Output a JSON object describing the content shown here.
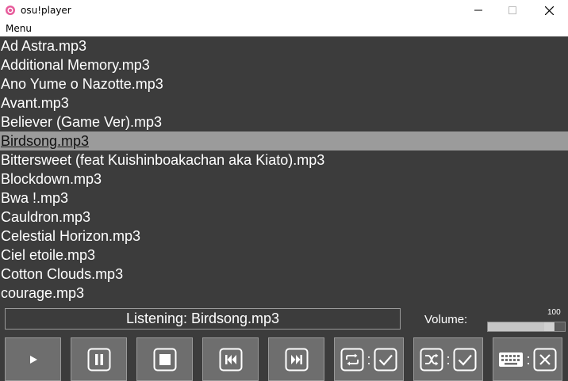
{
  "window": {
    "title": "osu!player",
    "minimize_glyph": "—",
    "maximize_glyph": "☐",
    "close_glyph": "✕"
  },
  "menu": {
    "label": "Menu"
  },
  "playlist": {
    "tracks": [
      "Ad Astra.mp3",
      "Additional Memory.mp3",
      "Ano Yume o Nazotte.mp3",
      "Avant.mp3",
      "Believer (Game Ver).mp3",
      "Birdsong.mp3",
      "Bittersweet (feat Kuishinboakachan aka Kiato).mp3",
      "Blockdown.mp3",
      "Bwa !.mp3",
      "Cauldron.mp3",
      "Celestial Horizon.mp3",
      "Ciel etoile.mp3",
      "Cotton Clouds.mp3",
      "courage.mp3"
    ],
    "selected_index": 5
  },
  "now_playing": {
    "text": "Listening: Birdsong.mp3"
  },
  "volume": {
    "label": "Volume:",
    "value": "100",
    "level_percent": 100
  },
  "controls": {
    "play_icon": "play-icon",
    "pause_icon": "pause-icon",
    "stop_icon": "stop-icon",
    "prev_icon": "skip-previous-icon",
    "next_icon": "skip-next-icon",
    "repeat_icon": "repeat-icon",
    "repeat_state": "checked",
    "shuffle_icon": "shuffle-icon",
    "shuffle_state": "checked",
    "keyboard_icon": "keyboard-icon",
    "keyboard_state": "unchecked",
    "separator": ":"
  },
  "colors": {
    "background": "#3c3c3c",
    "selected_row": "#9b9b9b",
    "button_face": "#6e6e6e"
  }
}
